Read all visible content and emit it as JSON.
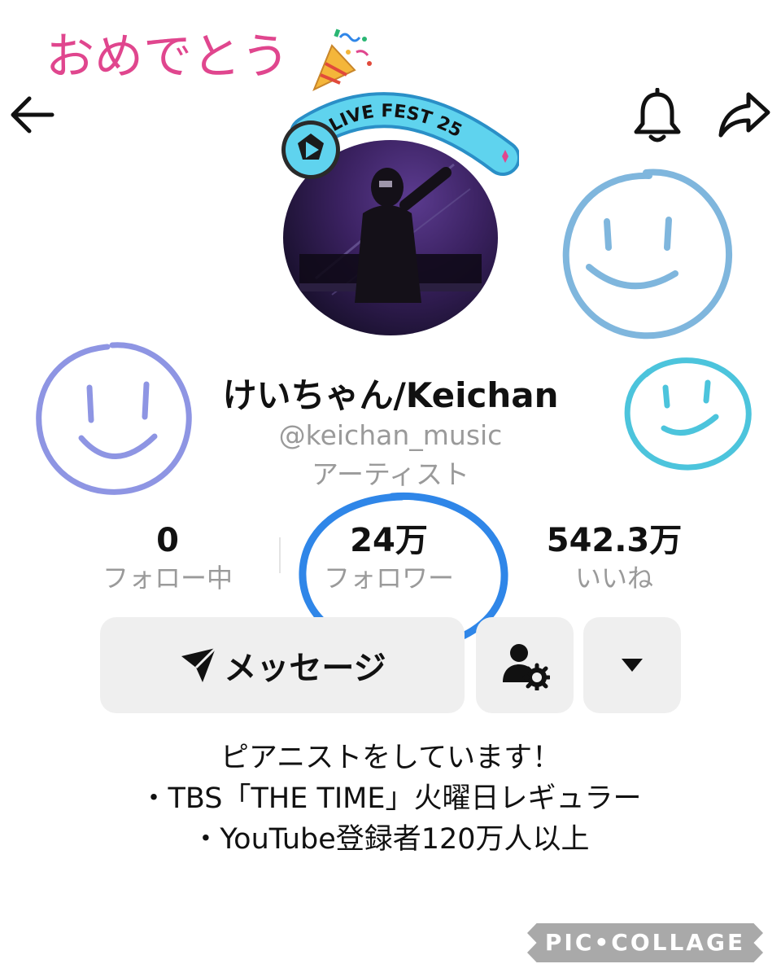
{
  "caption": "おめでとう",
  "header": {
    "back_icon": "arrow-left-icon",
    "bell_icon": "bell-icon",
    "share_icon": "share-arrow-icon"
  },
  "badge": {
    "text": "LIVE FEST 25"
  },
  "profile": {
    "name": "けいちゃん/Keichan",
    "handle": "@keichan_music",
    "category": "アーティスト"
  },
  "stats": [
    {
      "value": "0",
      "label": "フォロー中"
    },
    {
      "value": "24万",
      "label": "フォロワー"
    },
    {
      "value": "542.3万",
      "label": "いいね"
    }
  ],
  "actions": {
    "message_label": "メッセージ",
    "message_icon": "send-icon",
    "user_settings_icon": "user-gear-icon",
    "more_icon": "caret-down-icon"
  },
  "bio": [
    "ピアニストをしています！",
    "・TBS「THE TIME」火曜日レギュラー",
    "・YouTube登録者120万人以上"
  ],
  "watermark": "PIC•COLLAGE",
  "colors": {
    "caption": "#e0468e",
    "secondary_text": "#9a9a9a",
    "button_bg": "#efefef",
    "circle_highlight": "#2f86e8",
    "doodle_left": "#8e95e3",
    "doodle_right_top": "#7fb6dd",
    "doodle_right_bottom": "#4cc4dc"
  }
}
